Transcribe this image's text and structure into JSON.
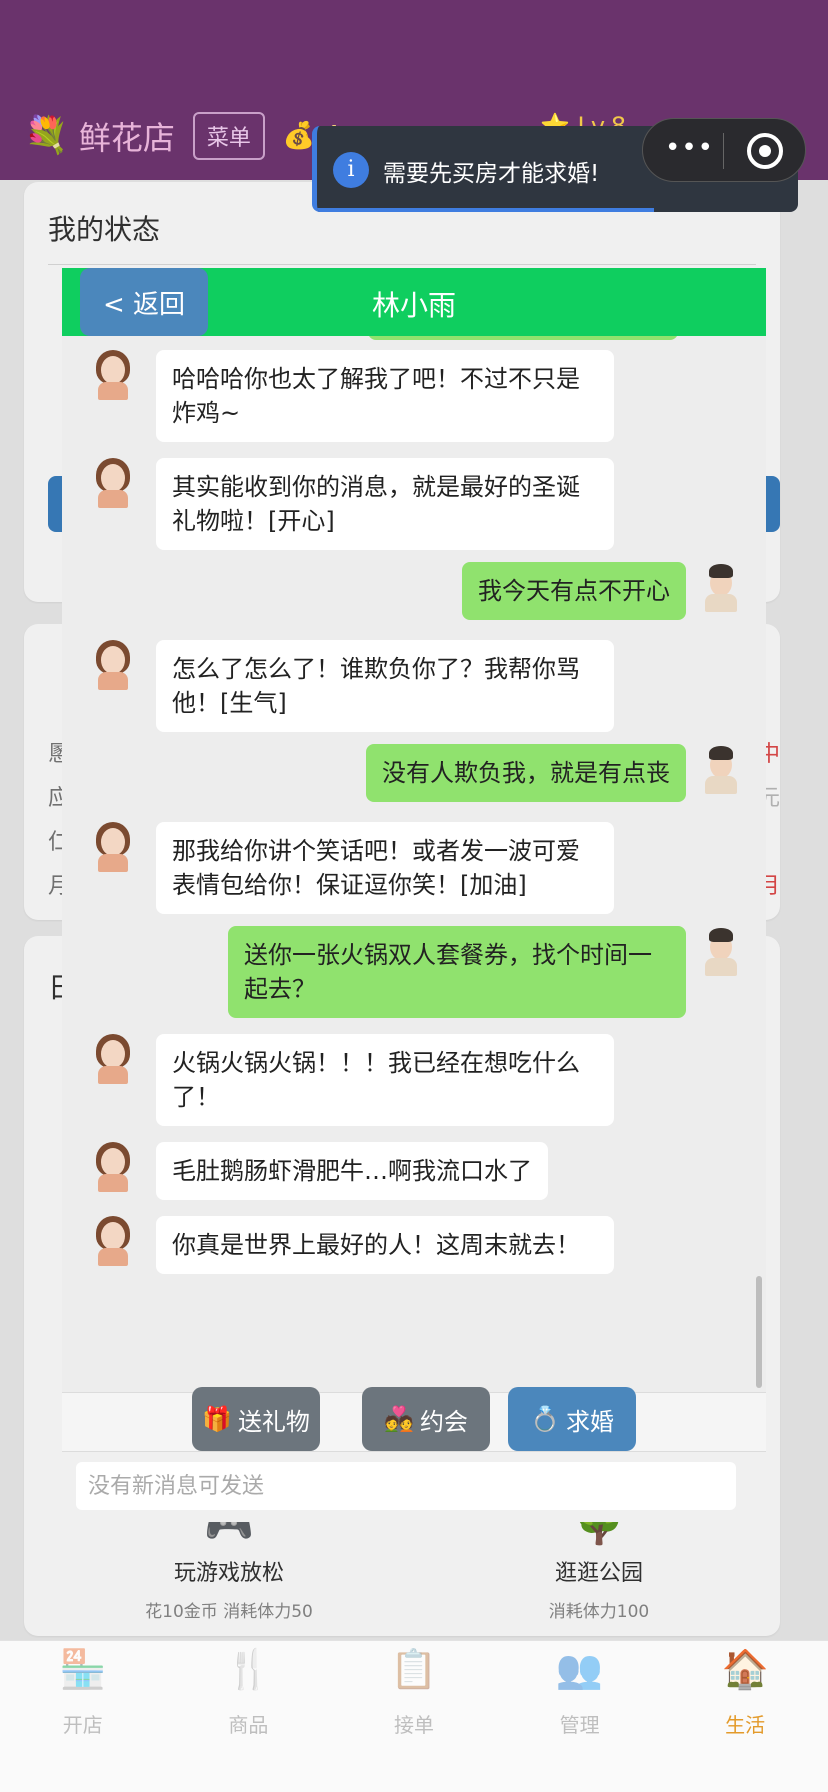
{
  "app": {
    "shop_name": "鲜花店",
    "menu_label": "菜单",
    "coins": "💰 4",
    "level": "⭐ Lv.8"
  },
  "status_card": {
    "title": "我的状态"
  },
  "info_card": {
    "rows_left": [
      "慁",
      "应",
      "仁",
      "月"
    ],
    "rows_right": [
      "中",
      "元",
      "",
      "月"
    ]
  },
  "daily_card": {
    "title": "日",
    "activities": [
      {
        "icon": "🎮",
        "name": "玩游戏放松",
        "cost": "花10金币 消耗体力50"
      },
      {
        "icon": "🌳",
        "name": "逛逛公园",
        "cost": "消耗体力100"
      }
    ]
  },
  "tabs": [
    {
      "icon": "🏪",
      "label": "开店",
      "icon_name": "shop-icon"
    },
    {
      "icon": "🍴",
      "label": "商品",
      "icon_name": "cutlery-icon"
    },
    {
      "icon": "📋",
      "label": "接单",
      "icon_name": "clipboard-icon"
    },
    {
      "icon": "👥",
      "label": "管理",
      "icon_name": "users-icon"
    },
    {
      "icon": "🏠",
      "label": "生活",
      "icon_name": "house-icon"
    }
  ],
  "chat": {
    "back_label": "< 返回",
    "contact_name": "林小雨",
    "messages": [
      {
        "from": "her",
        "text": "哈哈哈你也太了解我了吧！不过不只是炸鸡~"
      },
      {
        "from": "her",
        "text": "其实能收到你的消息，就是最好的圣诞礼物啦！[开心]"
      },
      {
        "from": "me",
        "text": "我今天有点不开心"
      },
      {
        "from": "her",
        "text": "怎么了怎么了！谁欺负你了？我帮你骂他！[生气]"
      },
      {
        "from": "me",
        "text": "没有人欺负我，就是有点丧"
      },
      {
        "from": "her",
        "text": "那我给你讲个笑话吧！或者发一波可爱表情包给你！保证逗你笑！[加油]"
      },
      {
        "from": "me",
        "text": "送你一张火锅双人套餐券，找个时间一起去？"
      },
      {
        "from": "her",
        "text": "火锅火锅火锅！！！我已经在想吃什么了！"
      },
      {
        "from": "her",
        "text": "毛肚鹅肠虾滑肥牛…啊我流口水了"
      },
      {
        "from": "her",
        "text": "你真是世界上最好的人！这周末就去！"
      }
    ],
    "actions": {
      "gift": {
        "icon": "🎁",
        "label": "送礼物"
      },
      "date": {
        "icon": "💑",
        "label": "约会"
      },
      "propose": {
        "icon": "💍",
        "label": "求婚"
      }
    },
    "input_placeholder": "没有新消息可发送"
  },
  "toast": {
    "icon": "i",
    "text": "需要先买房才能求婚!",
    "close": "×",
    "progress": 0.7
  },
  "capsule": {
    "more": "•••"
  }
}
